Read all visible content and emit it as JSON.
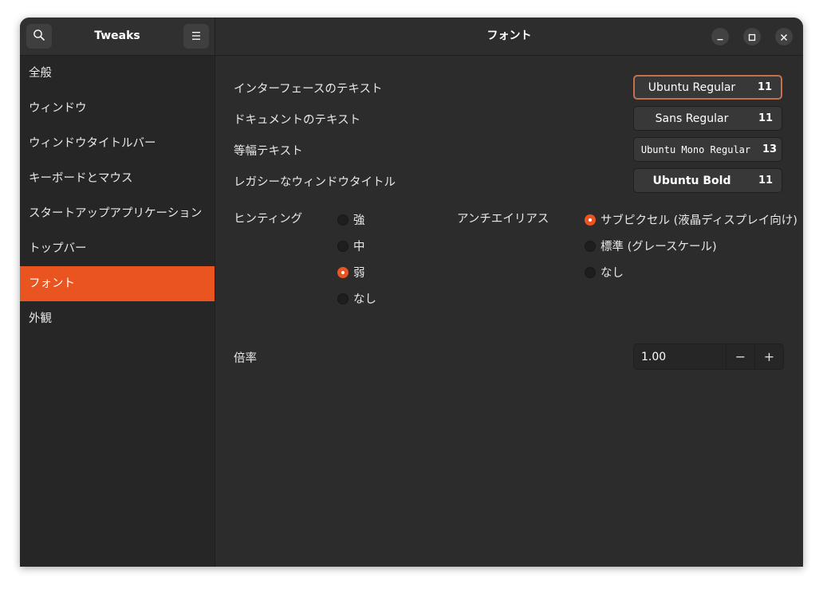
{
  "header": {
    "app_title": "Tweaks",
    "page_title": "フォント"
  },
  "sidebar": {
    "items": [
      {
        "label": "全般",
        "active": false
      },
      {
        "label": "ウィンドウ",
        "active": false
      },
      {
        "label": "ウィンドウタイトルバー",
        "active": false
      },
      {
        "label": "キーボードとマウス",
        "active": false
      },
      {
        "label": "スタートアップアプリケーション",
        "active": false
      },
      {
        "label": "トップバー",
        "active": false
      },
      {
        "label": "フォント",
        "active": true
      },
      {
        "label": "外観",
        "active": false
      }
    ]
  },
  "fonts": {
    "interface": {
      "label": "インターフェースのテキスト",
      "font": "Ubuntu Regular",
      "size": "11"
    },
    "document": {
      "label": "ドキュメントのテキスト",
      "font": "Sans Regular",
      "size": "11"
    },
    "monospace": {
      "label": "等幅テキスト",
      "font": "Ubuntu Mono Regular",
      "size": "13"
    },
    "legacy_title": {
      "label": "レガシーなウィンドウタイトル",
      "font": "Ubuntu Bold",
      "size": "11"
    }
  },
  "hinting": {
    "label": "ヒンティング",
    "options": [
      "強",
      "中",
      "弱",
      "なし"
    ],
    "selected": "弱"
  },
  "antialiasing": {
    "label": "アンチエイリアス",
    "options": [
      "サブピクセル (液晶ディスプレイ向け)",
      "標準 (グレースケール)",
      "なし"
    ],
    "selected": "サブピクセル (液晶ディスプレイ向け)"
  },
  "scaling": {
    "label": "倍率",
    "value": "1.00",
    "decrement": "−",
    "increment": "+"
  },
  "colors": {
    "accent": "#e95420",
    "focus_border": "#c7704e",
    "background": "#2c2c2c",
    "sidebar": "#262626"
  }
}
